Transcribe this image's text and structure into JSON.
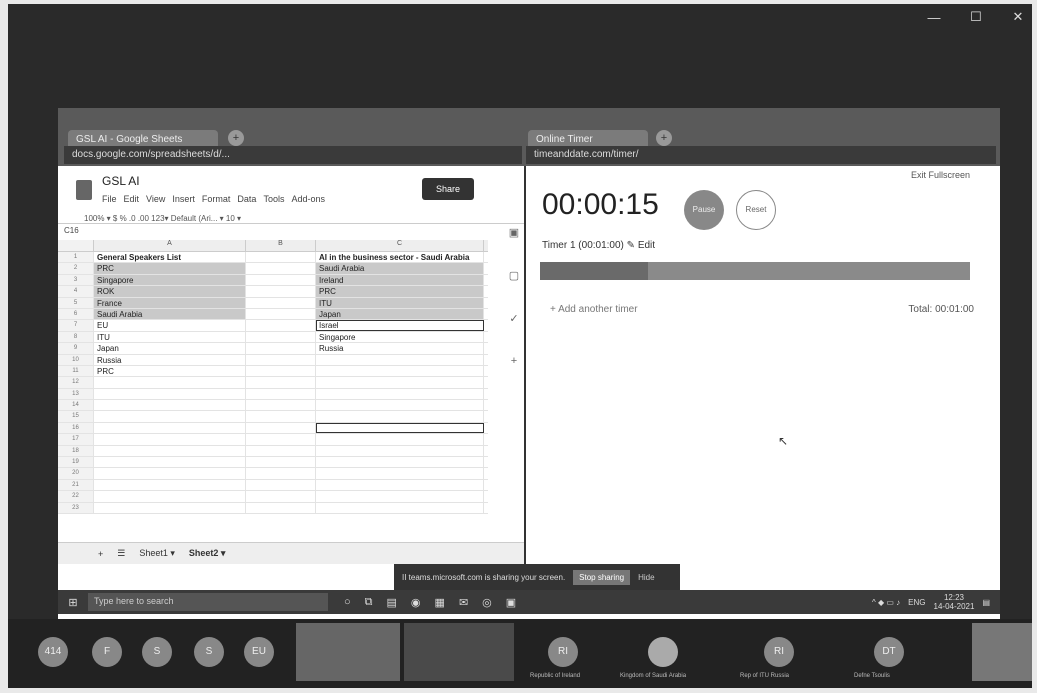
{
  "window_controls": [
    "—",
    "☐",
    "✕"
  ],
  "browser": {
    "left_tab": "GSL AI - Google Sheets",
    "left_url": "docs.google.com/spreadsheets/d/...",
    "right_tab": "Online Timer",
    "right_url": "timeanddate.com/timer/"
  },
  "sheets": {
    "title": "GSL AI",
    "menu": [
      "File",
      "Edit",
      "View",
      "Insert",
      "Format",
      "Data",
      "Tools",
      "Add-ons"
    ],
    "share_label": "Share",
    "toolbar_text": "100%  ▾   $   %   .0  .00  123▾   Default (Ari... ▾   10 ▾",
    "cell_ref": "C16",
    "columns": [
      "",
      "A",
      "B",
      "C"
    ],
    "rows": [
      {
        "n": "1",
        "a": "General Speakers List",
        "b": "",
        "c": "AI in the business sector - Saudi Arabia"
      },
      {
        "n": "2",
        "a": "PRC",
        "b": "",
        "c": "Saudi Arabia"
      },
      {
        "n": "3",
        "a": "Singapore",
        "b": "",
        "c": "Ireland"
      },
      {
        "n": "4",
        "a": "ROK",
        "b": "",
        "c": "PRC"
      },
      {
        "n": "5",
        "a": "France",
        "b": "",
        "c": "ITU"
      },
      {
        "n": "6",
        "a": "Saudi Arabia",
        "b": "",
        "c": "Japan"
      },
      {
        "n": "7",
        "a": "EU",
        "b": "",
        "c": "Israel"
      },
      {
        "n": "8",
        "a": "ITU",
        "b": "",
        "c": "Singapore"
      },
      {
        "n": "9",
        "a": "Japan",
        "b": "",
        "c": "Russia"
      },
      {
        "n": "10",
        "a": "Russia",
        "b": "",
        "c": ""
      },
      {
        "n": "11",
        "a": "PRC",
        "b": "",
        "c": ""
      },
      {
        "n": "12",
        "a": "",
        "b": "",
        "c": ""
      },
      {
        "n": "13",
        "a": "",
        "b": "",
        "c": ""
      },
      {
        "n": "14",
        "a": "",
        "b": "",
        "c": ""
      },
      {
        "n": "15",
        "a": "",
        "b": "",
        "c": ""
      },
      {
        "n": "16",
        "a": "",
        "b": "",
        "c": ""
      },
      {
        "n": "17",
        "a": "",
        "b": "",
        "c": ""
      },
      {
        "n": "18",
        "a": "",
        "b": "",
        "c": ""
      },
      {
        "n": "19",
        "a": "",
        "b": "",
        "c": ""
      },
      {
        "n": "20",
        "a": "",
        "b": "",
        "c": ""
      },
      {
        "n": "21",
        "a": "",
        "b": "",
        "c": ""
      },
      {
        "n": "22",
        "a": "",
        "b": "",
        "c": ""
      },
      {
        "n": "23",
        "a": "",
        "b": "",
        "c": ""
      }
    ],
    "sheet_tabs": [
      "+",
      "☰",
      "Sheet1 ▾",
      "Sheet2 ▾"
    ]
  },
  "timer": {
    "exit_fullscreen": "Exit Fullscreen",
    "time": "00:00:15",
    "pause_label": "Pause",
    "reset_label": "Reset",
    "label": "Timer 1 (00:01:00)  ✎ Edit",
    "add_label": "+  Add another timer",
    "total": "Total: 00:01:00",
    "progress": 0.25
  },
  "share_bar": {
    "message": "II  teams.microsoft.com is sharing your screen.",
    "stop_label": "Stop sharing",
    "hide_label": "Hide"
  },
  "taskbar": {
    "search_placeholder": "Type here to search",
    "time": "12:23",
    "date": "14-04-2021",
    "lang": "ENG"
  },
  "participants": {
    "avatars": [
      "414",
      "F",
      "S",
      "S",
      "EU"
    ],
    "tiles": [
      {
        "initials": "RI",
        "name": "Republic of Ireland"
      },
      {
        "initials": "",
        "name": "Kingdom of Saudi Arabia"
      },
      {
        "initials": "RI",
        "name": "Rep of ITU Russia"
      },
      {
        "initials": "DT",
        "name": "Defne Tsoulis"
      }
    ]
  }
}
